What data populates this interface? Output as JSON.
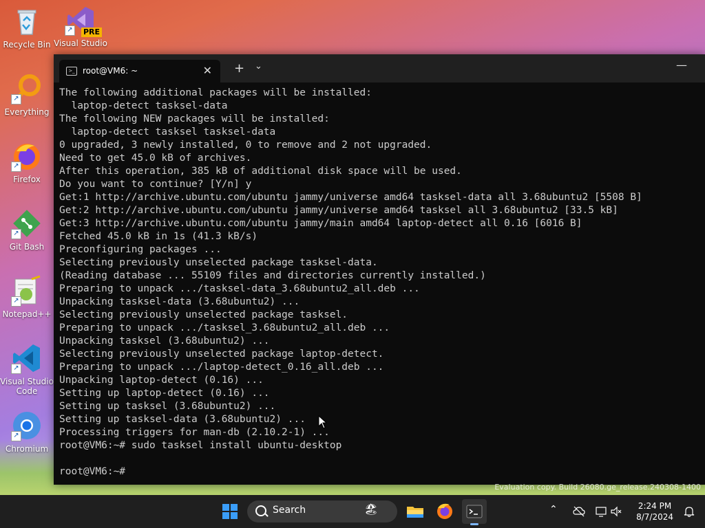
{
  "desktop": {
    "icons": [
      {
        "label": "Recycle Bin",
        "icon": "recycle-bin-icon"
      },
      {
        "label": "Visual Studio",
        "badge": "PRE",
        "icon": "visual-studio-icon"
      },
      {
        "label": "Everything",
        "icon": "everything-search-icon"
      },
      {
        "label": "Firefox",
        "icon": "firefox-icon"
      },
      {
        "label": "Git Bash",
        "icon": "git-bash-icon"
      },
      {
        "label": "Notepad++",
        "icon": "notepad-plus-plus-icon"
      },
      {
        "label": "Visual Studio Code",
        "icon": "vscode-icon"
      },
      {
        "label": "Chromium",
        "icon": "chromium-icon"
      }
    ],
    "watermark": "Evaluation copy. Build 26080.ge_release.240308-1400"
  },
  "terminal": {
    "tab_title": "root@VM6: ~",
    "new_tab_symbol": "+",
    "dropdown_symbol": "⌄",
    "close_symbol": "✕",
    "minimize_symbol": "—",
    "lines": [
      "The following additional packages will be installed:",
      "  laptop-detect tasksel-data",
      "The following NEW packages will be installed:",
      "  laptop-detect tasksel tasksel-data",
      "0 upgraded, 3 newly installed, 0 to remove and 2 not upgraded.",
      "Need to get 45.0 kB of archives.",
      "After this operation, 385 kB of additional disk space will be used.",
      "Do you want to continue? [Y/n] y",
      "Get:1 http://archive.ubuntu.com/ubuntu jammy/universe amd64 tasksel-data all 3.68ubuntu2 [5508 B]",
      "Get:2 http://archive.ubuntu.com/ubuntu jammy/universe amd64 tasksel all 3.68ubuntu2 [33.5 kB]",
      "Get:3 http://archive.ubuntu.com/ubuntu jammy/main amd64 laptop-detect all 0.16 [6016 B]",
      "Fetched 45.0 kB in 1s (41.3 kB/s)",
      "Preconfiguring packages ...",
      "Selecting previously unselected package tasksel-data.",
      "(Reading database ... 55109 files and directories currently installed.)",
      "Preparing to unpack .../tasksel-data_3.68ubuntu2_all.deb ...",
      "Unpacking tasksel-data (3.68ubuntu2) ...",
      "Selecting previously unselected package tasksel.",
      "Preparing to unpack .../tasksel_3.68ubuntu2_all.deb ...",
      "Unpacking tasksel (3.68ubuntu2) ...",
      "Selecting previously unselected package laptop-detect.",
      "Preparing to unpack .../laptop-detect_0.16_all.deb ...",
      "Unpacking laptop-detect (0.16) ...",
      "Setting up laptop-detect (0.16) ...",
      "Setting up tasksel (3.68ubuntu2) ...",
      "Setting up tasksel-data (3.68ubuntu2) ...",
      "Processing triggers for man-db (2.10.2-1) ...",
      "root@VM6:~# sudo tasksel install ubuntu-desktop",
      "",
      "root@VM6:~#"
    ]
  },
  "taskbar": {
    "search_label": "Search",
    "time": "2:24 PM",
    "date": "8/7/2024"
  }
}
